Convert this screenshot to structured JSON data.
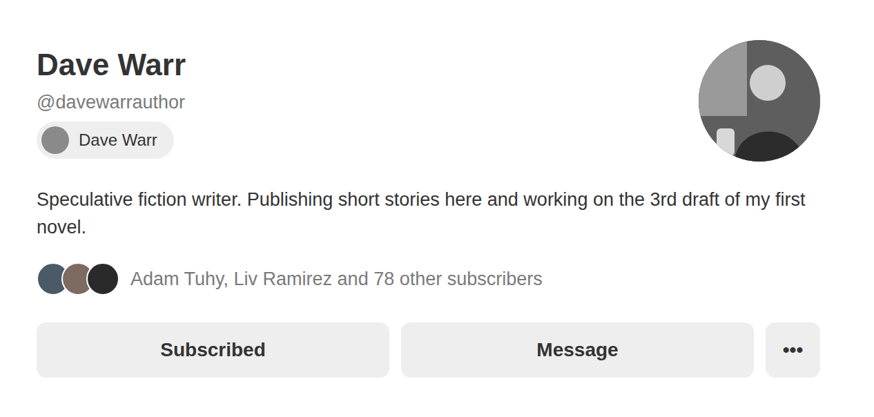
{
  "profile": {
    "name": "Dave Warr",
    "handle": "@davewarrauthor",
    "account_chip": {
      "label": "Dave Warr"
    },
    "bio": "Speculative fiction writer. Publishing short stories here and working on the 3rd draft of my first novel."
  },
  "subscribers": {
    "text": "Adam Tuhy, Liv Ramirez and 78 other subscribers"
  },
  "buttons": [
    {
      "label": "Subscribed"
    },
    {
      "label": "Message"
    },
    {
      "label": "•••"
    }
  ]
}
